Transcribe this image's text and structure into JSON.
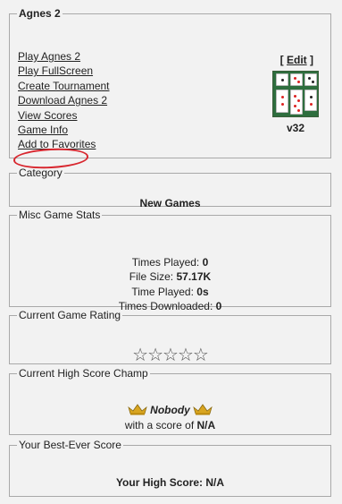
{
  "main": {
    "title": "Agnes 2",
    "links": [
      "Play Agnes 2",
      "Play FullScreen",
      "Create Tournament",
      "Download Agnes 2",
      "View Scores",
      "Game Info",
      "Add to Favorites"
    ],
    "edit_open": "[ ",
    "edit_label": "Edit",
    "edit_close": " ]",
    "version": "v32",
    "highlight_color": "#d8262e"
  },
  "category": {
    "title": "Category",
    "value": "New Games"
  },
  "stats": {
    "title": "Misc Game Stats",
    "times_played_label": "Times Played: ",
    "times_played": "0",
    "file_size_label": "File Size: ",
    "file_size": "57.17K",
    "time_played_label": "Time Played: ",
    "time_played": "0s",
    "times_downloaded_label": "Times Downloaded: ",
    "times_downloaded": "0"
  },
  "rating": {
    "title": "Current Game Rating",
    "stars": "☆☆☆☆☆"
  },
  "champ": {
    "title": "Current High Score Champ",
    "name": "Nobody",
    "score_prefix": "with a score of ",
    "score": "N/A"
  },
  "best": {
    "title": "Your Best-Ever Score",
    "label": "Your High Score: ",
    "value": "N/A"
  }
}
